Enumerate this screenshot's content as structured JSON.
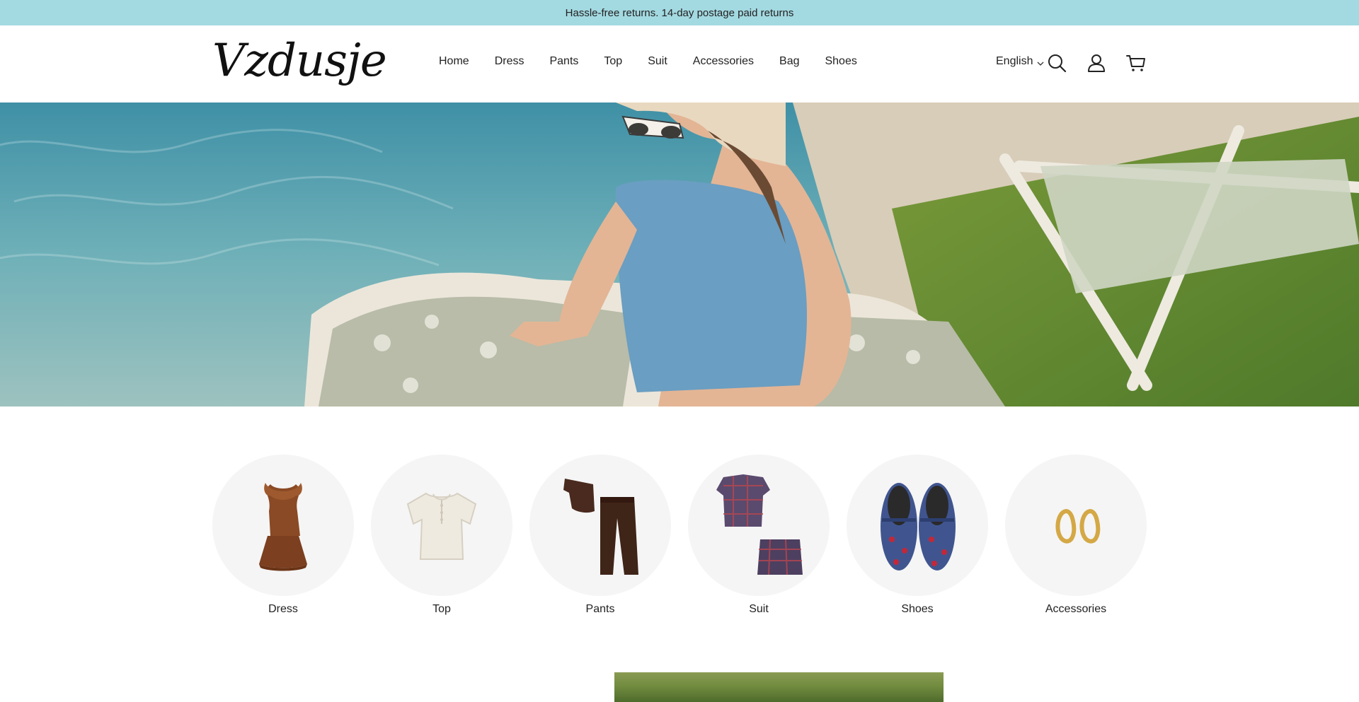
{
  "announcement": "Hassle-free returns. 14-day postage paid returns",
  "header": {
    "logo": "Vzdusje",
    "nav": [
      {
        "label": "Home"
      },
      {
        "label": "Dress"
      },
      {
        "label": "Pants"
      },
      {
        "label": "Top"
      },
      {
        "label": "Suit"
      },
      {
        "label": "Accessories"
      },
      {
        "label": "Bag"
      },
      {
        "label": "Shoes"
      }
    ],
    "language": "English",
    "icons": [
      "search-icon",
      "account-icon",
      "cart-icon"
    ]
  },
  "hero": {
    "alt_subject": "woman in sun hat and blue knit top lounging on pool float"
  },
  "categories": [
    {
      "label": "Dress",
      "icon": "dress-icon"
    },
    {
      "label": "Top",
      "icon": "top-icon"
    },
    {
      "label": "Pants",
      "icon": "pants-icon"
    },
    {
      "label": "Suit",
      "icon": "suit-icon"
    },
    {
      "label": "Shoes",
      "icon": "shoes-icon"
    },
    {
      "label": "Accessories",
      "icon": "earrings-icon"
    }
  ],
  "colors": {
    "announcement_bg": "#a3d9e1",
    "category_circle_bg": "#f5f5f5"
  }
}
